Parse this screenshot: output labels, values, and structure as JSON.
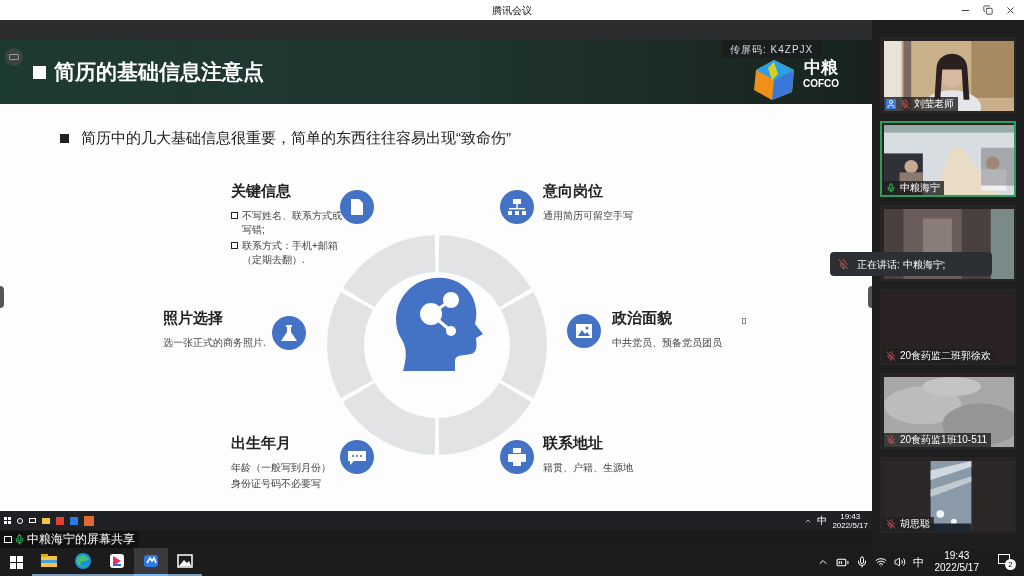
{
  "window": {
    "title": "腾讯会议"
  },
  "share": {
    "code": "传屏码: K4ZPJX",
    "sharer_label": "中粮海宁的屏幕共享",
    "sharer_speaking": true
  },
  "slide": {
    "title": "简历的基础信息注意点",
    "logo": {
      "cn": "中粮",
      "en": "COFCO"
    },
    "bullet": "简历中的几大基础信息很重要，简单的东西往往容易出现“致命伤”",
    "items": [
      {
        "title": "关键信息",
        "lines": [
          {
            "kind": "bullet",
            "text": "不写姓名、联系方式或写错;"
          },
          {
            "kind": "bullet",
            "text": "联系方式：手机+邮箱（定期去翻）."
          }
        ]
      },
      {
        "title": "意向岗位",
        "lines": [
          {
            "kind": "plain",
            "text": "通用简历可留空手写"
          }
        ]
      },
      {
        "title": "照片选择",
        "lines": [
          {
            "kind": "plain",
            "text": "选一张正式的商务照片."
          }
        ]
      },
      {
        "title": "政治面貌",
        "lines": [
          {
            "kind": "plain",
            "text": "中共党员、预备党员团员"
          }
        ]
      },
      {
        "title": "出生年月",
        "lines": [
          {
            "kind": "plain",
            "text": "年龄（一般写到月份）"
          },
          {
            "kind": "plain",
            "text": "身份证号码不必要写"
          }
        ]
      },
      {
        "title": "联系地址",
        "lines": [
          {
            "kind": "plain",
            "text": "籍贯、户籍、生源地"
          }
        ]
      }
    ]
  },
  "remote_taskbar": {
    "ime": "中",
    "time": "19:43",
    "date": "2022/5/17"
  },
  "participants": [
    {
      "name": "刘莹老师",
      "speaking": false,
      "selected": false
    },
    {
      "name": "中粮海宁",
      "speaking": true,
      "selected": true
    },
    {
      "selected": false
    },
    {
      "name": "20食药监二班郭徐欢",
      "speaking": false,
      "selected": false
    },
    {
      "name": "20食药监1班10-511",
      "speaking": false,
      "selected": false
    },
    {
      "name": "胡思聪",
      "speaking": false,
      "selected": false
    }
  ],
  "toast": {
    "text": "正在讲话: 中粮海宁;"
  },
  "taskbar": {
    "apps": [
      {
        "selected": false
      },
      {
        "selected": false
      },
      {
        "selected": false
      },
      {
        "selected": true
      },
      {
        "selected": false
      }
    ],
    "ime": "中",
    "time": "19:43",
    "date": "2022/5/17",
    "notifications": "2"
  }
}
